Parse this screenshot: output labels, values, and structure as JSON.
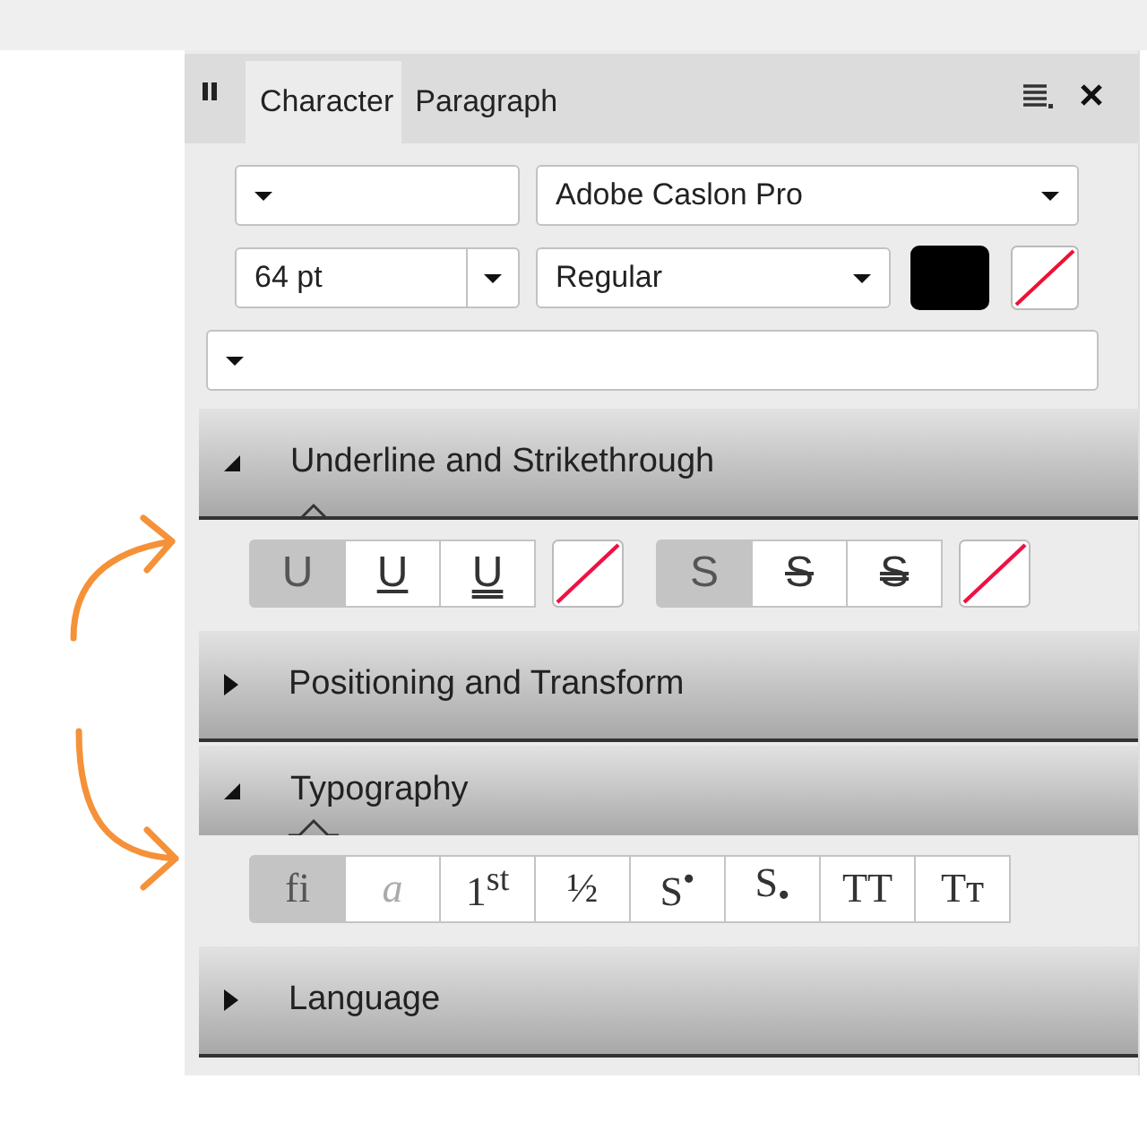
{
  "panel": {
    "tabs": [
      {
        "label": "Character",
        "selected": true
      },
      {
        "label": "Paragraph",
        "selected": false
      }
    ],
    "font_family": "Adobe Caslon Pro",
    "font_size": "64 pt",
    "font_style": "Regular",
    "sections": [
      {
        "title": "Underline and Strikethrough",
        "expanded": true,
        "groups": [
          [
            {
              "kind": "plain",
              "glyph": "U",
              "selected": true
            },
            {
              "kind": "underline",
              "glyph": "U",
              "selected": false
            },
            {
              "kind": "double-underline",
              "glyph": "U",
              "selected": false
            },
            {
              "kind": "swatch"
            }
          ],
          [
            {
              "kind": "plain",
              "glyph": "S",
              "selected": true
            },
            {
              "kind": "strike",
              "glyph": "S",
              "selected": false
            },
            {
              "kind": "double-strike",
              "glyph": "S",
              "selected": false
            },
            {
              "kind": "swatch"
            }
          ]
        ]
      },
      {
        "title": "Positioning and Transform",
        "expanded": false
      },
      {
        "title": "Typography",
        "expanded": true,
        "groups": [
          [
            {
              "kind": "serif",
              "glyph": "fi",
              "selected": true,
              "disabled": false
            },
            {
              "kind": "serif",
              "glyph": "a",
              "selected": false,
              "disabled": true
            },
            {
              "kind": "serif",
              "glyph": "1$^{st}$",
              "selected": false,
              "disabled": false
            },
            {
              "kind": "serif",
              "glyph": "½",
              "selected": false,
              "disabled": false
            },
            {
              "kind": "serif",
              "glyph": "S$^{•}$",
              "selected": false,
              "disabled": false
            },
            {
              "kind": "serif",
              "glyph": "S$_{•}$",
              "selected": false,
              "disabled": false
            },
            {
              "kind": "serif",
              "glyph": "TT",
              "selected": false,
              "disabled": false
            },
            {
              "kind": "serif",
              "glyph": "Tᴛ",
              "selected": false,
              "disabled": false
            }
          ]
        ]
      },
      {
        "title": "Language",
        "expanded": false
      }
    ]
  }
}
